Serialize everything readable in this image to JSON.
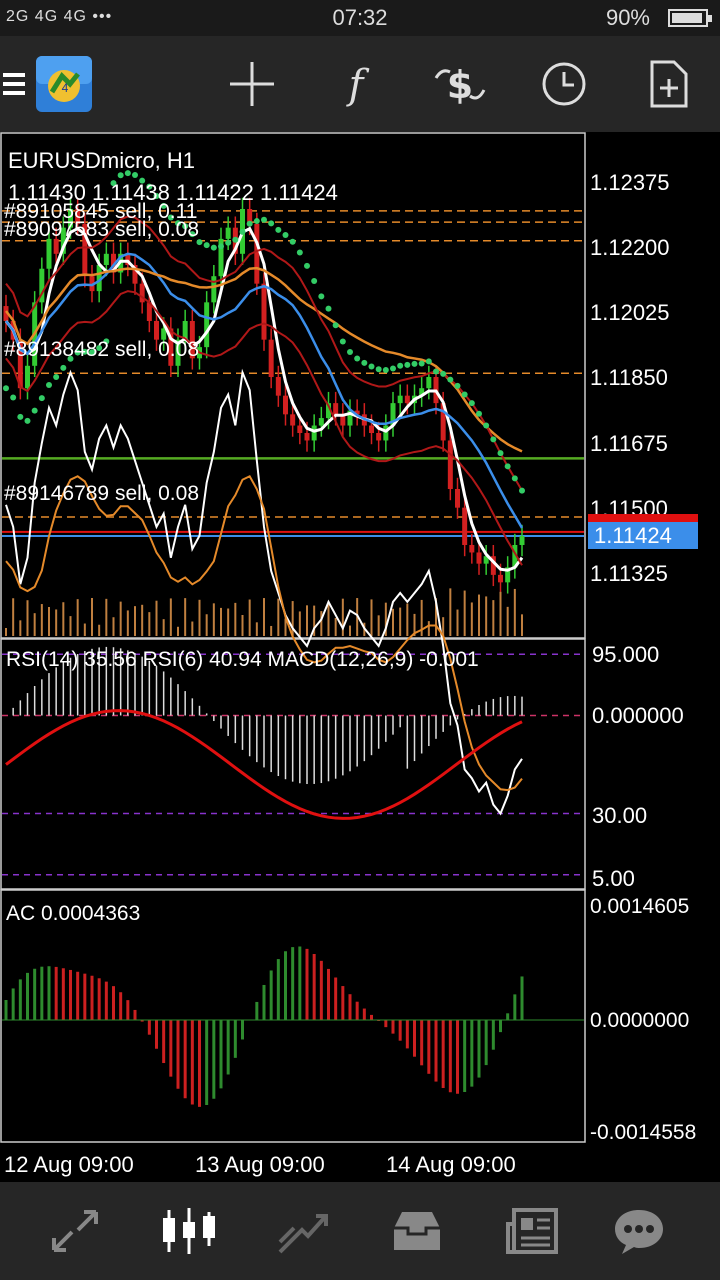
{
  "status_bar": {
    "signal": "2G 4G 4G",
    "dots": "•••",
    "time": "07:32",
    "battery": "90%"
  },
  "toolbar": {
    "menu_icon": "hamburger-menu-icon",
    "app_icon": "metatrader-logo-icon",
    "crosshair_icon": "crosshair-icon",
    "indicators_icon": "function-f-icon",
    "symbol_icon": "dollar-exchange-icon",
    "period_icon": "clock-icon",
    "new_order_icon": "new-document-icon"
  },
  "main_chart": {
    "symbol_label": "EURUSDmicro, H1",
    "ohlc": "1.11430 1.11438 1.11422 1.11424",
    "orders": [
      "#89105845 sell, 0.11",
      "#89097583 sell, 0.08",
      "#89138482 sell, 0.08",
      "#89146789 sell, 0.08"
    ],
    "price_ticks": [
      "1.12375",
      "1.12200",
      "1.12025",
      "1.11850",
      "1.11675",
      "1.11500",
      "1.11325"
    ],
    "current_price": "1.11424",
    "price_red_line": "1.11435",
    "colors": {
      "bull": "#33cc33",
      "bear": "#d32020",
      "bid_line": "#3b8eea",
      "order_line": "#e58a2a"
    }
  },
  "chart_data": {
    "type": "candlestick",
    "title": "EURUSDmicro, H1",
    "ylim": [
      1.1123,
      1.1246
    ],
    "x_labels": [
      "12 Aug 09:00",
      "13 Aug 09:00",
      "14 Aug 09:00"
    ],
    "last_close": 1.11424
  },
  "rsi_panel": {
    "label": "RSI(14) 35.56 RSI(6) 40.94 MACD(12,26,9) -0.001",
    "ticks": [
      "95.000",
      "0.000000",
      "30.00",
      "5.00"
    ]
  },
  "ac_panel": {
    "label": "AC 0.0004363",
    "ticks": [
      "0.0014605",
      "0.0000000",
      "-0.0014558"
    ]
  },
  "time_axis": [
    "12 Aug 09:00",
    "13 Aug 09:00",
    "14 Aug 09:00"
  ],
  "bottom_nav": [
    {
      "name": "quotes",
      "icon": "arrows-updown-icon"
    },
    {
      "name": "chart",
      "icon": "candlestick-icon"
    },
    {
      "name": "trade",
      "icon": "trade-trend-icon"
    },
    {
      "name": "history",
      "icon": "inbox-icon"
    },
    {
      "name": "news",
      "icon": "newspaper-icon"
    },
    {
      "name": "messages",
      "icon": "chat-bubble-icon"
    }
  ]
}
